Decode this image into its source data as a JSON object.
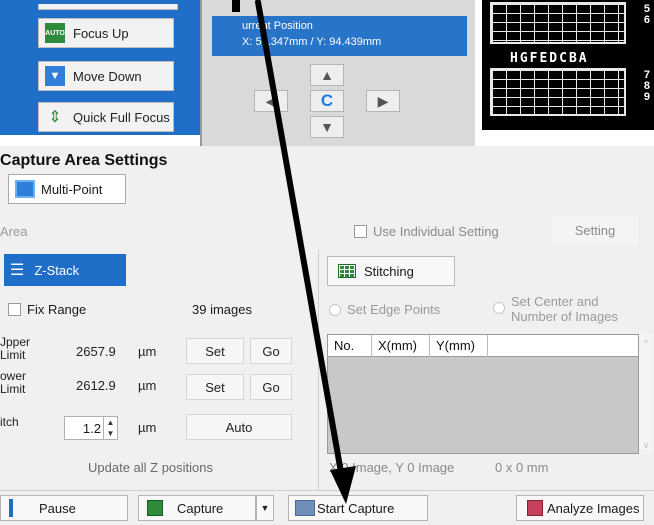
{
  "focus_buttons": [
    {
      "label": "Focus Up",
      "icon": "auto-focus-up-icon"
    },
    {
      "label": "Move Down",
      "icon": "arrow-down-icon"
    },
    {
      "label": "Quick Full Focus",
      "icon": "quick-focus-icon"
    }
  ],
  "position": {
    "label": "urrent Position",
    "value": "50.347mm / Y: 94.439mm",
    "center_label": "C"
  },
  "plate": {
    "letters": "HGFEDCBA",
    "top_rows": [
      "5",
      "6"
    ],
    "bottom_rows": [
      "7",
      "8",
      "9"
    ]
  },
  "capture_area": {
    "title": "apture Area Settings",
    "multi_point_label": "Multi-Point",
    "area_label": "Area",
    "use_individual_label": "Use Individual Setting",
    "setting_label": "Setting"
  },
  "zstack": {
    "tab_label": "Z-Stack",
    "fix_range_label": "Fix Range",
    "images_count": "39 images",
    "upper_label": "Jpper\nLimit",
    "upper_value": "2657.9",
    "lower_label": "ower\nLimit",
    "lower_value": "2612.9",
    "pitch_label": "itch",
    "pitch_value": "1.2",
    "unit": "µm",
    "set_label": "Set",
    "go_label": "Go",
    "auto_label": "Auto",
    "update_label": "Update all Z positions"
  },
  "stitching": {
    "button_label": "Stitching",
    "edge_points_label": "Set Edge Points",
    "center_label_1": "Set Center and",
    "center_label_2": "Number of Images",
    "columns": [
      "No.",
      "X(mm)",
      "Y(mm)"
    ],
    "image_status": "X 0 Image, Y 0 Image",
    "image_size": "0 x 0 mm"
  },
  "bottom_bar": {
    "pause_label": "Pause",
    "capture_label": "Capture",
    "start_capture_label": "Start Capture",
    "analyze_label": "Analyze Images"
  },
  "colors": {
    "accent_blue": "#1f6fc8",
    "panel_gray": "#f0f0f0",
    "annotation_arrow": "#000000"
  }
}
